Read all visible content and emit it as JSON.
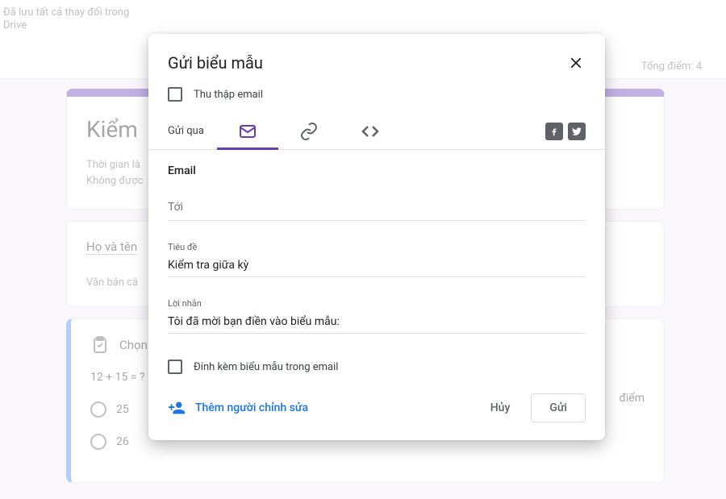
{
  "topbar": {
    "save_status": "Đã lưu tất cả thay đổi trong Drive",
    "points_total": "Tổng điểm: 4"
  },
  "bg": {
    "form_title": "Kiểm",
    "form_desc1": "Thời gian là",
    "form_desc2": "Không được",
    "q1_label": "Họ và tên",
    "q1_placeholder": "Văn bản câ",
    "choice_label": "Chọn",
    "q2_text": "12 + 15 = ?",
    "q2_points": "điểm",
    "opt1": "25",
    "opt2": "26"
  },
  "modal": {
    "title": "Gửi biểu mẫu",
    "collect_emails": "Thu thập email",
    "send_via": "Gửi qua",
    "email_section": "Email",
    "to_label": "Tới",
    "to_value": "",
    "subject_label": "Tiêu đề",
    "subject_value": "Kiểm tra giữa kỳ",
    "message_label": "Lời nhắn",
    "message_value": "Tôi đã mời bạn điền vào biểu mẫu:",
    "include_form": "Đính kèm biểu mẫu trong email",
    "add_collaborators": "Thêm người chỉnh sửa",
    "cancel": "Hủy",
    "send": "Gửi"
  }
}
